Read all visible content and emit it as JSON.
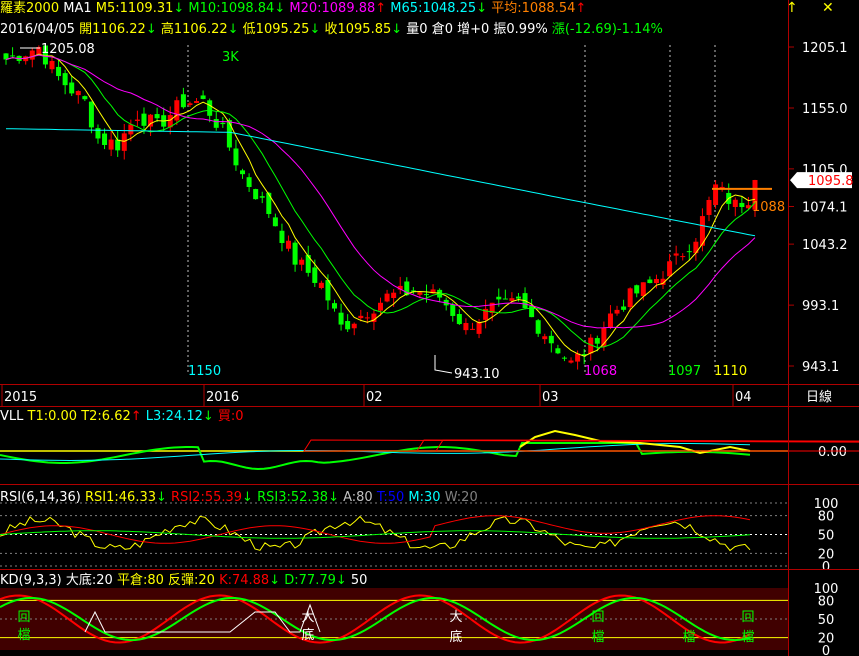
{
  "header": {
    "row1": [
      {
        "text": "羅素2000",
        "color": "#ffff00"
      },
      {
        "text": " MA1 ",
        "color": "#ffffff"
      },
      {
        "text": "M5:1109.31",
        "color": "#ffff00"
      },
      {
        "text": "↓",
        "color": "#00ff00"
      },
      {
        "text": " M10:1098.84",
        "color": "#00ff00"
      },
      {
        "text": "↓",
        "color": "#00ff00"
      },
      {
        "text": " M20:1089.88",
        "color": "#ff00ff"
      },
      {
        "text": "↑",
        "color": "#ff0000"
      },
      {
        "text": " M65:1048.25",
        "color": "#00ffff"
      },
      {
        "text": "↓",
        "color": "#00ff00"
      },
      {
        "text": " 平均:1088.54",
        "color": "#ff8000"
      },
      {
        "text": "↑",
        "color": "#ff0000"
      }
    ],
    "row2": [
      {
        "text": "2016/04/05 ",
        "color": "#ffffff"
      },
      {
        "text": "開1106.22",
        "color": "#ffff00"
      },
      {
        "text": "↓",
        "color": "#00ff00"
      },
      {
        "text": " 高1106.22",
        "color": "#ffff00"
      },
      {
        "text": "↓",
        "color": "#00ff00"
      },
      {
        "text": " 低1095.25",
        "color": "#ffff00"
      },
      {
        "text": "↓",
        "color": "#00ff00"
      },
      {
        "text": " 收1095.85",
        "color": "#ffff00"
      },
      {
        "text": "↓",
        "color": "#00ff00"
      },
      {
        "text": " 量0 倉0 增+0 振0.99%",
        "color": "#ffffff"
      },
      {
        "text": " 漲(-12.69)-1.14%",
        "color": "#00ff00"
      }
    ],
    "up_arrow_icon": "↑",
    "close_icon": "✕"
  },
  "price_axis": [
    "1205.1",
    "1155.0",
    "1105.0",
    "1074.1",
    "1043.2",
    "993.1",
    "943.1"
  ],
  "price_axis_values": [
    1205.1,
    1155.0,
    1105.0,
    1074.1,
    1043.2,
    993.1,
    943.1
  ],
  "current_price_tag": "1095.8",
  "annotations": {
    "high_label": "1205.08",
    "low_label": "943.10",
    "three_k": "3K",
    "avg_label": "1088",
    "markers": [
      {
        "text": "1150",
        "color": "#00ffff"
      },
      {
        "text": "1068",
        "color": "#ff00ff"
      },
      {
        "text": "1097",
        "color": "#00ff00"
      },
      {
        "text": "1110",
        "color": "#ffff00"
      }
    ]
  },
  "time_axis": {
    "labels": [
      "2015",
      "2016",
      "02",
      "03",
      "04"
    ],
    "unit": "日線"
  },
  "vll": {
    "header": [
      {
        "text": "VLL ",
        "color": "#ffffff"
      },
      {
        "text": "T1:0.00",
        "color": "#ffff00"
      },
      {
        "text": " T2:6.62",
        "color": "#ffff00"
      },
      {
        "text": "↑",
        "color": "#ff0000"
      },
      {
        "text": " L3:24.12",
        "color": "#00ffff"
      },
      {
        "text": "↓",
        "color": "#00ff00"
      },
      {
        "text": " 買:0",
        "color": "#ff0000"
      }
    ],
    "axis": [
      "0.00"
    ]
  },
  "rsi": {
    "header": [
      {
        "text": "RSI(6,14,36) ",
        "color": "#ffffff"
      },
      {
        "text": "RSI1:46.33",
        "color": "#ffff00"
      },
      {
        "text": "↓",
        "color": "#00ff00"
      },
      {
        "text": " RSI2:55.39",
        "color": "#ff0000"
      },
      {
        "text": "↓",
        "color": "#00ff00"
      },
      {
        "text": " RSI3:52.38",
        "color": "#00ff00"
      },
      {
        "text": "↓",
        "color": "#00ff00"
      },
      {
        "text": " A:80",
        "color": "#c0c0c0"
      },
      {
        "text": " T:50",
        "color": "#0000ff"
      },
      {
        "text": " M:30",
        "color": "#00ffff"
      },
      {
        "text": " W:20",
        "color": "#808080"
      }
    ],
    "axis": [
      "100",
      "80",
      "50",
      "20",
      "0"
    ],
    "axis_values": [
      100,
      80,
      50,
      20,
      0
    ]
  },
  "kd": {
    "header": [
      {
        "text": "KD(9,3,3) ",
        "color": "#ffffff"
      },
      {
        "text": "大底:20",
        "color": "#ffffff"
      },
      {
        "text": " 平倉:80",
        "color": "#ffff00"
      },
      {
        "text": " 反彈:20",
        "color": "#ffff00"
      },
      {
        "text": " K:74.88",
        "color": "#ff0000"
      },
      {
        "text": "↓",
        "color": "#00ff00"
      },
      {
        "text": " D:77.79",
        "color": "#00ff00"
      },
      {
        "text": "↓",
        "color": "#00ff00"
      },
      {
        "text": " 50",
        "color": "#ffffff"
      }
    ],
    "axis": [
      "100",
      "80",
      "50",
      "20",
      "0"
    ],
    "axis_values": [
      100,
      80,
      50,
      20,
      0
    ],
    "signals": [
      "回",
      "檔",
      "大",
      "底",
      "大",
      "底",
      "回",
      "檔",
      "檔",
      "回",
      "檔"
    ]
  },
  "colors": {
    "up_candle": "#ff0000",
    "down_candle": "#00ff00",
    "ma5": "#ffff00",
    "ma10": "#00ff00",
    "ma20": "#ff00ff",
    "ma65": "#00ffff",
    "avg": "#ff8000",
    "grid": "#b00000"
  }
}
